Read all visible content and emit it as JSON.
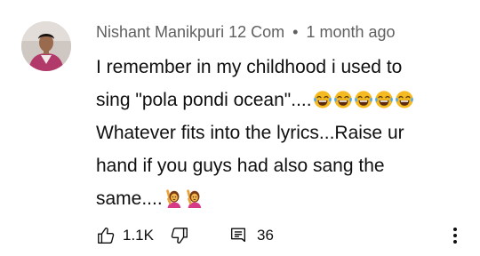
{
  "comment": {
    "author": "Nishant Manikpuri 12 Com",
    "separator": "•",
    "timestamp": "1 month ago",
    "lines": [
      "I remember in my childhood i used to",
      "sing \"pola pondi ocean\"....",
      "Whatever fits into the lyrics...Raise ur",
      "hand if you guys  had also sang the",
      "same...."
    ],
    "laughing_emoji_count": 5,
    "raising_hand_emoji_count": 2,
    "likes": "1.1K",
    "replies": "36"
  },
  "icons": {
    "avatar": "avatar",
    "laugh": "face-with-tears-of-joy-icon",
    "raise_hand": "person-raising-hand-icon",
    "like": "thumbs-up-icon",
    "dislike": "thumbs-down-icon",
    "reply": "reply-icon",
    "menu": "more-vertical-icon"
  },
  "colors": {
    "text": "#0f0f0f",
    "meta": "#606060",
    "emoji_yellow": "#f5b922",
    "background": "#ffffff"
  }
}
